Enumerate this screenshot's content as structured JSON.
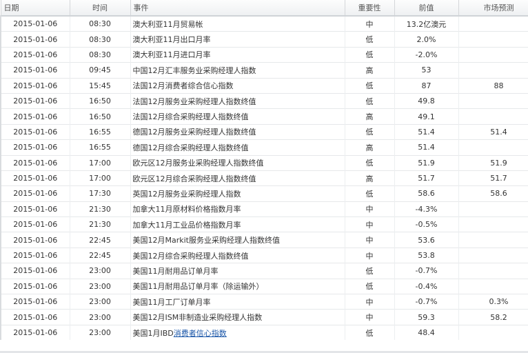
{
  "header": {
    "date": "日期",
    "time": "时间",
    "event": "事件",
    "importance": "重要性",
    "previous": "前值",
    "forecast": "市场预测"
  },
  "rows": [
    {
      "date": "2015-01-06",
      "time": "08:30",
      "event": "澳大利亚11月贸易帐",
      "importance": "中",
      "previous": "13.2亿澳元",
      "forecast": ""
    },
    {
      "date": "2015-01-06",
      "time": "08:30",
      "event": "澳大利亚11月出口月率",
      "importance": "低",
      "previous": "2.0%",
      "forecast": ""
    },
    {
      "date": "2015-01-06",
      "time": "08:30",
      "event": "澳大利亚11月进口月率",
      "importance": "低",
      "previous": "-2.0%",
      "forecast": ""
    },
    {
      "date": "2015-01-06",
      "time": "09:45",
      "event": "中国12月汇丰服务业采购经理人指数",
      "importance": "高",
      "previous": "53",
      "forecast": ""
    },
    {
      "date": "2015-01-06",
      "time": "15:45",
      "event": "法国12月消费者综合信心指数",
      "importance": "低",
      "previous": "87",
      "forecast": "88"
    },
    {
      "date": "2015-01-06",
      "time": "16:50",
      "event": "法国12月服务业采购经理人指数终值",
      "importance": "低",
      "previous": "49.8",
      "forecast": ""
    },
    {
      "date": "2015-01-06",
      "time": "16:50",
      "event": "法国12月综合采购经理人指数终值",
      "importance": "高",
      "previous": "49.1",
      "forecast": ""
    },
    {
      "date": "2015-01-06",
      "time": "16:55",
      "event": "德国12月服务业采购经理人指数终值",
      "importance": "低",
      "previous": "51.4",
      "forecast": "51.4"
    },
    {
      "date": "2015-01-06",
      "time": "16:55",
      "event": "德国12月综合采购经理人指数终值",
      "importance": "高",
      "previous": "51.4",
      "forecast": ""
    },
    {
      "date": "2015-01-06",
      "time": "17:00",
      "event": "欧元区12月服务业采购经理人指数终值",
      "importance": "低",
      "previous": "51.9",
      "forecast": "51.9"
    },
    {
      "date": "2015-01-06",
      "time": "17:00",
      "event": "欧元区12月综合采购经理人指数终值",
      "importance": "高",
      "previous": "51.7",
      "forecast": "51.7"
    },
    {
      "date": "2015-01-06",
      "time": "17:30",
      "event": "英国12月服务业采购经理人指数",
      "importance": "低",
      "previous": "58.6",
      "forecast": "58.6"
    },
    {
      "date": "2015-01-06",
      "time": "21:30",
      "event": "加拿大11月原材料价格指数月率",
      "importance": "中",
      "previous": "-4.3%",
      "forecast": ""
    },
    {
      "date": "2015-01-06",
      "time": "21:30",
      "event": "加拿大11月工业品价格指数月率",
      "importance": "中",
      "previous": "-0.5%",
      "forecast": ""
    },
    {
      "date": "2015-01-06",
      "time": "22:45",
      "event": "美国12月Markit服务业采购经理人指数终值",
      "importance": "中",
      "previous": "53.6",
      "forecast": ""
    },
    {
      "date": "2015-01-06",
      "time": "22:45",
      "event": "美国12月综合采购经理人指数终值",
      "importance": "中",
      "previous": "53.8",
      "forecast": ""
    },
    {
      "date": "2015-01-06",
      "time": "23:00",
      "event": "美国11月耐用品订单月率",
      "importance": "低",
      "previous": "-0.7%",
      "forecast": ""
    },
    {
      "date": "2015-01-06",
      "time": "23:00",
      "event": "美国11月耐用品订单月率（除运输外）",
      "importance": "低",
      "previous": "-0.4%",
      "forecast": ""
    },
    {
      "date": "2015-01-06",
      "time": "23:00",
      "event": "美国11月工厂订单月率",
      "importance": "中",
      "previous": "-0.7%",
      "forecast": "0.3%"
    },
    {
      "date": "2015-01-06",
      "time": "23:00",
      "event": "美国12月ISM非制造业采购经理人指数",
      "importance": "中",
      "previous": "59.3",
      "forecast": "58.2"
    },
    {
      "date": "2015-01-06",
      "time": "23:00",
      "event": "美国1月IBD消费者信心指数",
      "importance": "低",
      "previous": "48.4",
      "forecast": "",
      "event_prefix": "美国1月IBD",
      "event_link": "消费者信心指数"
    }
  ]
}
